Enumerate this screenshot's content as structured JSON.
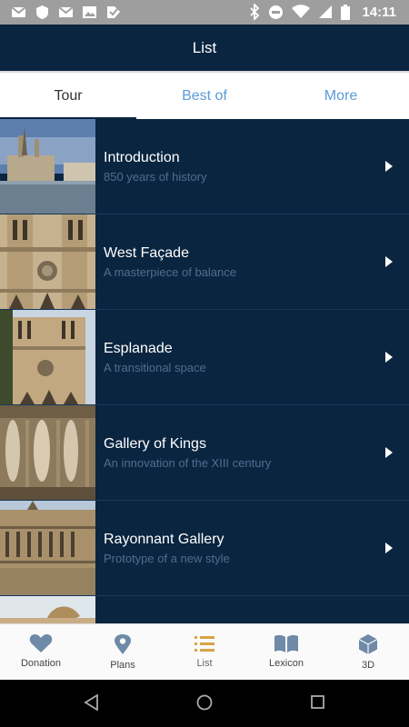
{
  "status": {
    "time": "14:11"
  },
  "app": {
    "title": "List"
  },
  "tabs": [
    {
      "label": "Tour",
      "active": true
    },
    {
      "label": "Best of",
      "active": false
    },
    {
      "label": "More",
      "active": false
    }
  ],
  "list": [
    {
      "title": "Introduction",
      "subtitle": "850 years of history"
    },
    {
      "title": "West Façade",
      "subtitle": "A masterpiece of balance"
    },
    {
      "title": "Esplanade",
      "subtitle": "A transitional space"
    },
    {
      "title": "Gallery of Kings",
      "subtitle": "An innovation of the XIII century"
    },
    {
      "title": "Rayonnant Gallery",
      "subtitle": "Prototype of a new style"
    }
  ],
  "bottom_nav": [
    {
      "label": "Donation",
      "icon": "heart-icon"
    },
    {
      "label": "Plans",
      "icon": "map-pin-icon"
    },
    {
      "label": "List",
      "icon": "list-icon",
      "active": true
    },
    {
      "label": "Lexicon",
      "icon": "book-icon"
    },
    {
      "label": "3D",
      "icon": "cube-icon"
    }
  ],
  "colors": {
    "primary": "#0a2540",
    "accent": "#d9a441",
    "tab_inactive": "#5b9bd5"
  }
}
